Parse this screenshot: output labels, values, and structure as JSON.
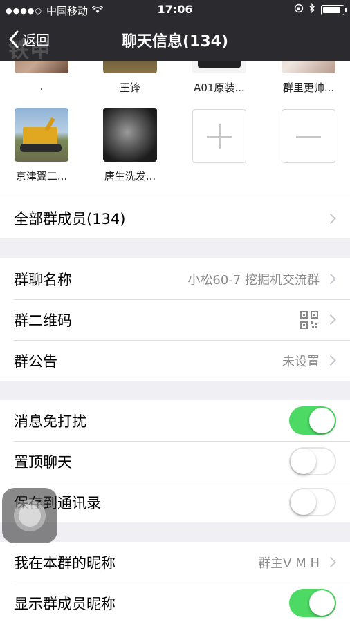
{
  "status_bar": {
    "carrier": "中国移动",
    "time": "17:06",
    "battery_level": 0.9
  },
  "nav": {
    "back_label": "返回",
    "title": "聊天信息(134)",
    "watermark": "铁甲"
  },
  "members": [
    {
      "name": "."
    },
    {
      "name": "王锋"
    },
    {
      "name": "A01原装..."
    },
    {
      "name": "群里更帅..."
    },
    {
      "name": "京津翼二..."
    },
    {
      "name": "唐生洗发..."
    }
  ],
  "all_members_label": "全部群成员(134)",
  "group_info": {
    "name_label": "群聊名称",
    "name_value": "小松60-7 挖掘机交流群",
    "qr_label": "群二维码",
    "notice_label": "群公告",
    "notice_value": "未设置"
  },
  "settings": {
    "mute_label": "消息免打扰",
    "mute_on": true,
    "pin_label": "置顶聊天",
    "pin_on": false,
    "save_label": "保存到通讯录",
    "save_on": false
  },
  "profile": {
    "nickname_label": "我在本群的昵称",
    "nickname_value": "群主V M H",
    "show_nick_label": "显示群成员昵称",
    "show_nick_on": true
  },
  "colors": {
    "header_bg": "#2b2b2f",
    "switch_on": "#4cd964",
    "page_bg": "#efeff4"
  }
}
